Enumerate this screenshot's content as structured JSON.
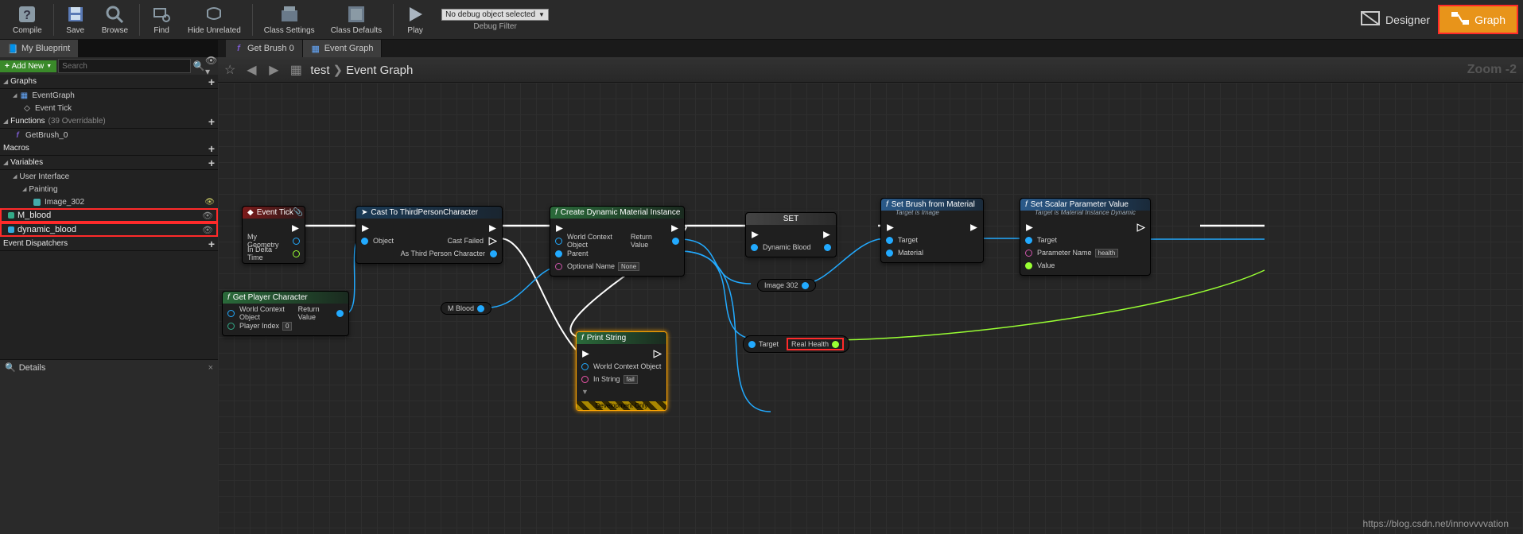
{
  "toolbar": {
    "compile": "Compile",
    "save": "Save",
    "browse": "Browse",
    "find": "Find",
    "hide_unrelated": "Hide Unrelated",
    "class_settings": "Class Settings",
    "class_defaults": "Class Defaults",
    "play": "Play",
    "debug_selected": "No debug object selected",
    "debug_filter": "Debug Filter",
    "designer": "Designer",
    "graph": "Graph"
  },
  "left_tabs": {
    "my_blueprint": "My Blueprint"
  },
  "center_tabs": {
    "getbrush": "Get Brush 0",
    "eventgraph": "Event Graph"
  },
  "addnew": "Add New",
  "search_placeholder": "Search",
  "sections": {
    "graphs": "Graphs",
    "functions": "Functions",
    "functions_cnt": "(39 Overridable)",
    "macros": "Macros",
    "variables": "Variables",
    "event_dispatchers": "Event Dispatchers",
    "user_interface": "User Interface",
    "painting": "Painting"
  },
  "tree": {
    "eventgraph": "EventGraph",
    "event_tick": "Event Tick",
    "getbrush0": "GetBrush_0",
    "image302": "Image_302",
    "m_blood": "M_blood",
    "dynamic_blood": "dynamic_blood"
  },
  "details": "Details",
  "breadcrumb": {
    "root": "test",
    "leaf": "Event Graph"
  },
  "zoom": "Zoom -2",
  "nodes": {
    "event_tick": {
      "title": "Event Tick",
      "my_geometry": "My Geometry",
      "in_delta": "In Delta Time"
    },
    "cast": {
      "title": "Cast To ThirdPersonCharacter",
      "object": "Object",
      "cast_failed": "Cast Failed",
      "as_tpc": "As Third Person Character"
    },
    "gpc": {
      "title": "Get Player Character",
      "wco": "World Context Object",
      "pidx": "Player Index",
      "pidx_val": "0",
      "ret": "Return Value"
    },
    "cdmi": {
      "title": "Create Dynamic Material Instance",
      "wco": "World Context Object",
      "parent": "Parent",
      "opt": "Optional Name",
      "opt_val": "None",
      "ret": "Return Value"
    },
    "set": {
      "title": "SET",
      "dyn": "Dynamic Blood"
    },
    "sbfm": {
      "title": "Set Brush from Material",
      "sub": "Target is Image",
      "target": "Target",
      "material": "Material"
    },
    "sspv": {
      "title": "Set Scalar Parameter Value",
      "sub": "Target is Material Instance Dynamic",
      "target": "Target",
      "param": "Parameter Name",
      "param_val": "health",
      "value": "Value"
    },
    "ps": {
      "title": "Print String",
      "wco": "World Context Object",
      "instr": "In String",
      "instr_val": "fail",
      "dev": "Development Only"
    },
    "mblood": "M Blood",
    "image302": "Image 302",
    "target": "Target",
    "realhealth": "Real Health"
  },
  "watermark": "https://blog.csdn.net/innovvvvation"
}
